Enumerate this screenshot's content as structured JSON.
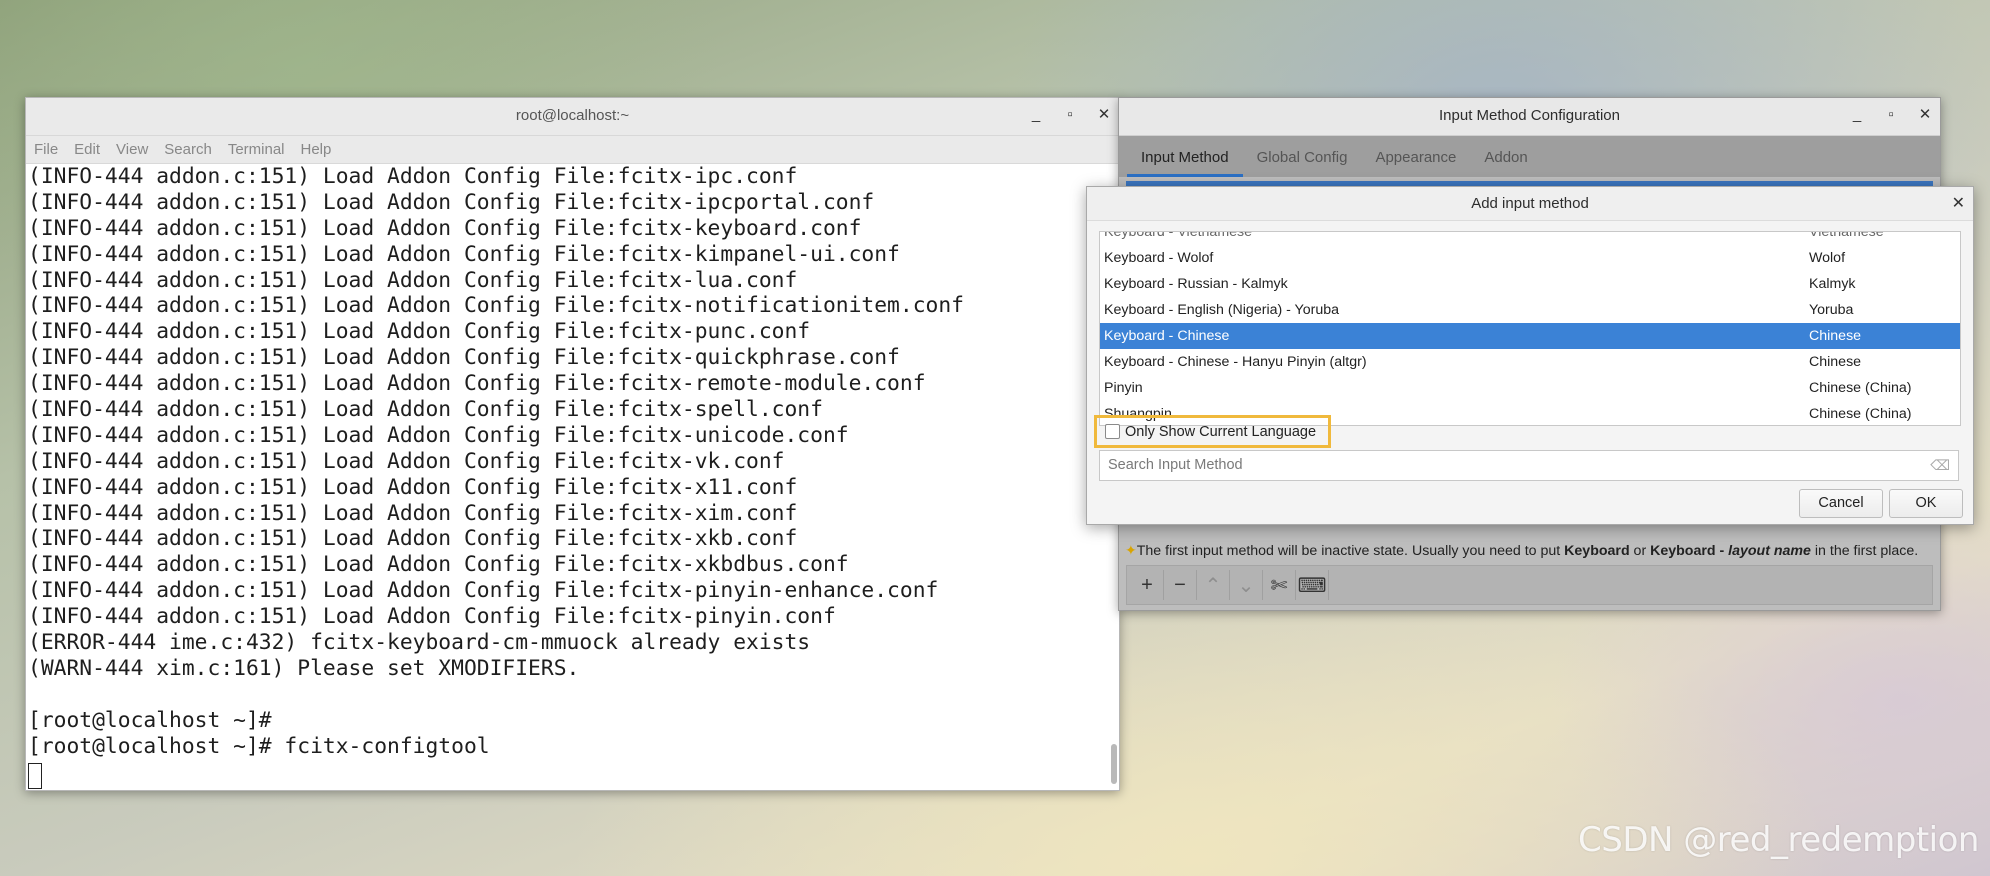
{
  "terminal": {
    "title": "root@localhost:~",
    "menu": [
      "File",
      "Edit",
      "View",
      "Search",
      "Terminal",
      "Help"
    ],
    "lines": [
      "(INFO-444 addon.c:151) Load Addon Config File:fcitx-ipc.conf",
      "(INFO-444 addon.c:151) Load Addon Config File:fcitx-ipcportal.conf",
      "(INFO-444 addon.c:151) Load Addon Config File:fcitx-keyboard.conf",
      "(INFO-444 addon.c:151) Load Addon Config File:fcitx-kimpanel-ui.conf",
      "(INFO-444 addon.c:151) Load Addon Config File:fcitx-lua.conf",
      "(INFO-444 addon.c:151) Load Addon Config File:fcitx-notificationitem.conf",
      "(INFO-444 addon.c:151) Load Addon Config File:fcitx-punc.conf",
      "(INFO-444 addon.c:151) Load Addon Config File:fcitx-quickphrase.conf",
      "(INFO-444 addon.c:151) Load Addon Config File:fcitx-remote-module.conf",
      "(INFO-444 addon.c:151) Load Addon Config File:fcitx-spell.conf",
      "(INFO-444 addon.c:151) Load Addon Config File:fcitx-unicode.conf",
      "(INFO-444 addon.c:151) Load Addon Config File:fcitx-vk.conf",
      "(INFO-444 addon.c:151) Load Addon Config File:fcitx-x11.conf",
      "(INFO-444 addon.c:151) Load Addon Config File:fcitx-xim.conf",
      "(INFO-444 addon.c:151) Load Addon Config File:fcitx-xkb.conf",
      "(INFO-444 addon.c:151) Load Addon Config File:fcitx-xkbdbus.conf",
      "(INFO-444 addon.c:151) Load Addon Config File:fcitx-pinyin-enhance.conf",
      "(INFO-444 addon.c:151) Load Addon Config File:fcitx-pinyin.conf",
      "(ERROR-444 ime.c:432) fcitx-keyboard-cm-mmuock already exists",
      "(WARN-444 xim.c:161) Please set XMODIFIERS.",
      "",
      "[root@localhost ~]#",
      "[root@localhost ~]# fcitx-configtool"
    ]
  },
  "imconfig": {
    "title": "Input Method Configuration",
    "tabs": [
      "Input Method",
      "Global Config",
      "Appearance",
      "Addon"
    ],
    "active_tab": "Input Method",
    "hint_pre": "The first input method will be inactive state. Usually you need to put ",
    "hint_b1": "Keyboard",
    "hint_mid": " or ",
    "hint_b2": "Keyboard - ",
    "hint_i": "layout name",
    "hint_post": " in the first place.",
    "toolbar": [
      {
        "icon": "add-icon",
        "glyph": "+"
      },
      {
        "icon": "remove-icon",
        "glyph": "−"
      },
      {
        "icon": "move-up-icon",
        "glyph": "⌃"
      },
      {
        "icon": "move-down-icon",
        "glyph": "⌄"
      },
      {
        "icon": "configure-icon",
        "glyph": "✄"
      },
      {
        "icon": "keyboard-icon",
        "glyph": "⌨"
      }
    ]
  },
  "dialog": {
    "title": "Add input method",
    "partial_row": {
      "name": "Keyboard - Vietnamese",
      "lang": "Vietnamese"
    },
    "rows": [
      {
        "name": "Keyboard - Wolof",
        "lang": "Wolof"
      },
      {
        "name": "Keyboard - Russian - Kalmyk",
        "lang": "Kalmyk"
      },
      {
        "name": "Keyboard - English (Nigeria) - Yoruba",
        "lang": "Yoruba"
      },
      {
        "name": "Keyboard - Chinese",
        "lang": "Chinese",
        "selected": true
      },
      {
        "name": "Keyboard - Chinese - Hanyu Pinyin (altgr)",
        "lang": "Chinese"
      },
      {
        "name": "Pinyin",
        "lang": "Chinese (China)"
      },
      {
        "name": "Shuangpin",
        "lang": "Chinese (China)"
      }
    ],
    "only_current_label": "Only Show Current Language",
    "only_current_checked": false,
    "search_placeholder": "Search Input Method",
    "cancel_label": "Cancel",
    "ok_label": "OK",
    "highlight_color": "#3b82d6",
    "callout_color": "#f0b93c"
  },
  "watermark": "CSDN @red_redemption"
}
